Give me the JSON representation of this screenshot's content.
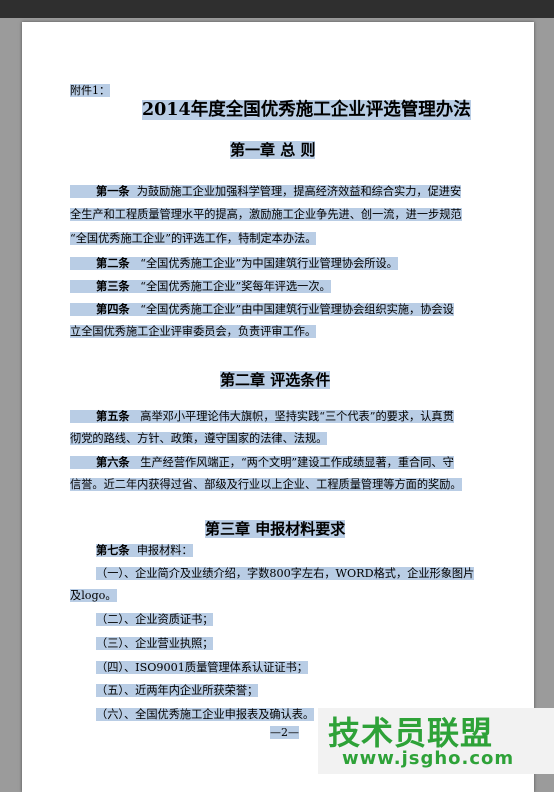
{
  "attachment": "附件1：",
  "title": "2014年度全国优秀施工企业评选管理办法",
  "chapter1": {
    "title": "第一章    总    则",
    "art1_label": "第一条",
    "art1_l1": "为鼓励施工企业加强科学管理，提高经济效益和综合实力，促进安",
    "art1_l2": "全生产和工程质量管理水平的提高，激励施工企业争先进、创一流，进一步规范",
    "art1_l3": "“全国优秀施工企业”的评选工作，特制定本办法。",
    "art2_label": "第二条",
    "art2_text": "“全国优秀施工企业”为中国建筑行业管理协会所设。",
    "art3_label": "第三条",
    "art3_text": "“全国优秀施工企业”奖每年评选一次。",
    "art4_label": "第四条",
    "art4_l1": "“全国优秀施工企业”由中国建筑行业管理协会组织实施，协会设",
    "art4_l2": "立全国优秀施工企业评审委员会，负责评审工作。"
  },
  "chapter2": {
    "title": "第二章    评选条件",
    "art5_label": "第五条",
    "art5_l1": "高举邓小平理论伟大旗帜，坚持实践“三个代表”的要求，认真贯",
    "art5_l2": "彻党的路线、方针、政策，遵守国家的法律、法规。",
    "art6_label": "第六条",
    "art6_l1": "生产经营作风端正，“两个文明”建设工作成绩显著，重合同、守",
    "art6_l2": "信誉。近二年内获得过省、部级及行业以上企业、工程质量管理等方面的奖励。"
  },
  "chapter3": {
    "title": "第三章    申报材料要求",
    "art7_label": "第七条",
    "art7_text": "申报材料：",
    "item1_l1": "（一）、企业简介及业绩介绍，字数800字左右，WORD格式，企业形象图片",
    "item1_l2": "及logo。",
    "item2": "（二）、企业资质证书；",
    "item3": "（三）、企业营业执照；",
    "item4": "（四）、ISO9001质量管理体系认证证书；",
    "item5": "（五）、近两年内企业所获荣誉；",
    "item6": "（六）、全国优秀施工企业申报表及确认表。"
  },
  "page_number": "—2—",
  "watermark": {
    "name": "技术员联盟",
    "url": "www.jsgho.com",
    "color": "#2ea238"
  }
}
